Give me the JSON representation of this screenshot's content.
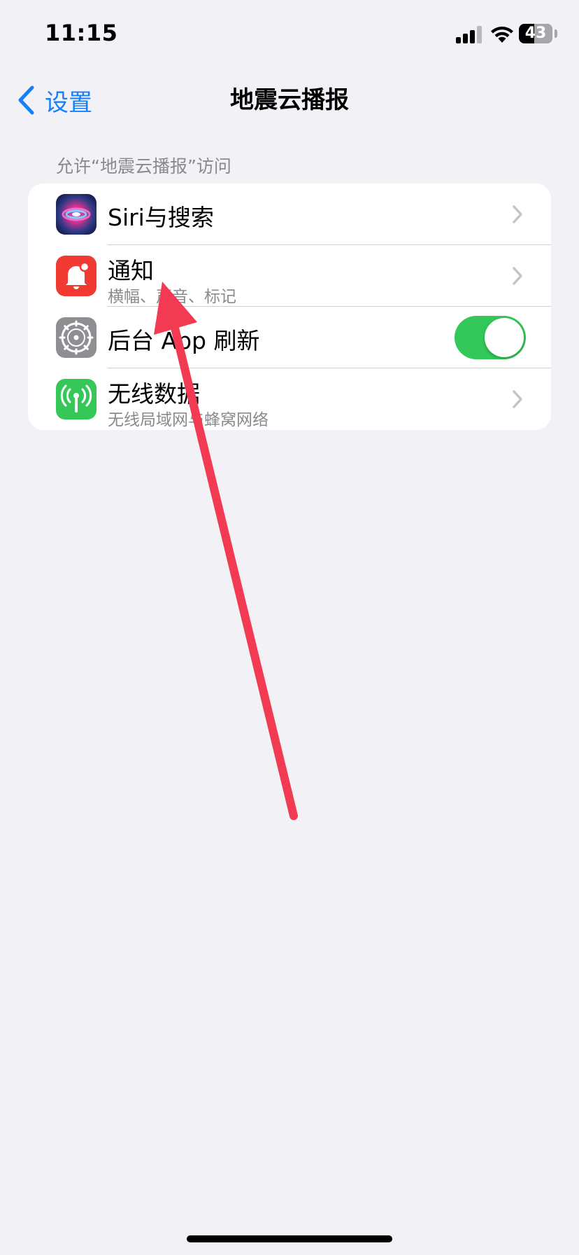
{
  "status_bar": {
    "time": "11:15",
    "battery_percent": "43",
    "battery_level": 0.43,
    "signal_bars_active": 3,
    "signal_bars_total": 4
  },
  "nav": {
    "back_label": "设置",
    "title": "地震云播报"
  },
  "section": {
    "header": "允许“地震云播报”访问",
    "rows": [
      {
        "title": "Siri与搜索",
        "subtitle": "",
        "icon": "siri-icon",
        "accessory": "chevron"
      },
      {
        "title": "通知",
        "subtitle": "横幅、声音、标记",
        "icon": "bell-icon",
        "accessory": "chevron"
      },
      {
        "title": "后台 App 刷新",
        "subtitle": "",
        "icon": "gear-icon",
        "accessory": "toggle",
        "toggle_on": true
      },
      {
        "title": "无线数据",
        "subtitle": "无线局域网与蜂窝网络",
        "icon": "antenna-icon",
        "accessory": "chevron"
      }
    ]
  },
  "colors": {
    "background": "#f2f1f6",
    "accent": "#1580f9",
    "toggle_on": "#34c759",
    "annotation_arrow": "#f23a52"
  }
}
